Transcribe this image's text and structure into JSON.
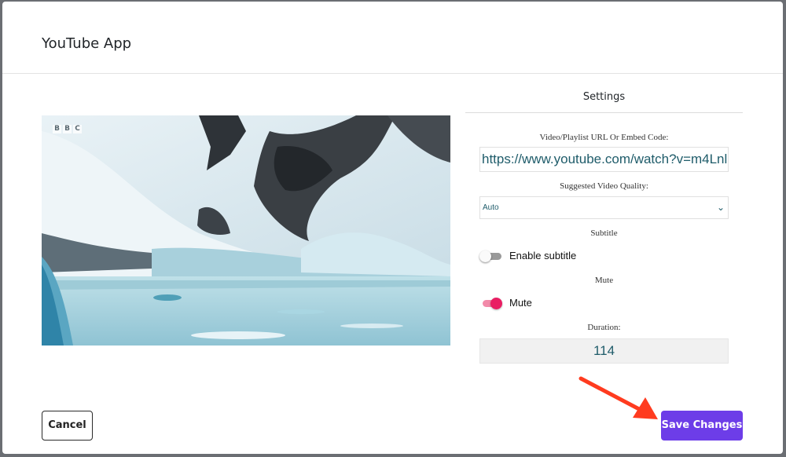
{
  "app_title": "YouTube App",
  "video_preview": {
    "watermark_letters": [
      "B",
      "B",
      "C"
    ]
  },
  "settings": {
    "header": "Settings",
    "url_label": "Video/Playlist URL Or Embed Code:",
    "url_value": "https://www.youtube.com/watch?v=m4Lnl",
    "quality_label": "Suggested Video Quality:",
    "quality_value": "Auto",
    "subtitle_section": "Subtitle",
    "subtitle_toggle_label": "Enable subtitle",
    "subtitle_enabled": false,
    "mute_section": "Mute",
    "mute_toggle_label": "Mute",
    "mute_enabled": true,
    "duration_label": "Duration:",
    "duration_value": "114"
  },
  "footer": {
    "cancel_label": "Cancel",
    "save_label": "Save Changes"
  },
  "colors": {
    "accent": "#6d3de8",
    "toggle_on": "#e91e63",
    "annotation_arrow": "#ff3b1f"
  }
}
